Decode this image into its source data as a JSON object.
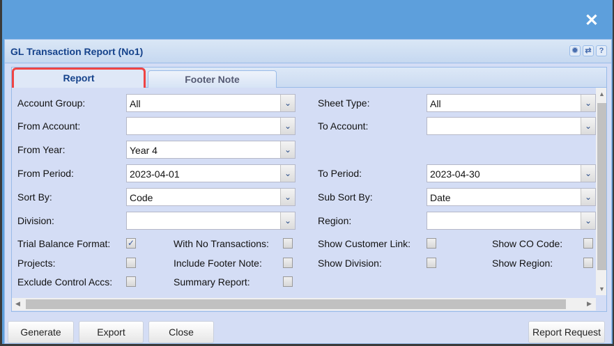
{
  "window": {
    "close_icon": "close-icon"
  },
  "dialog": {
    "title": "GL Transaction Report (No1)",
    "tools": [
      "gear-icon",
      "refresh-icon",
      "help-icon"
    ]
  },
  "tabs": [
    {
      "label": "Report",
      "active": true
    },
    {
      "label": "Footer Note",
      "active": false
    }
  ],
  "fields": {
    "account_group": {
      "label": "Account Group:",
      "value": "All"
    },
    "sheet_type": {
      "label": "Sheet Type:",
      "value": "All"
    },
    "from_account": {
      "label": "From Account:",
      "value": ""
    },
    "to_account": {
      "label": "To Account:",
      "value": ""
    },
    "from_year": {
      "label": "From Year:",
      "value": "Year 4"
    },
    "from_period": {
      "label": "From Period:",
      "value": "2023-04-01"
    },
    "to_period": {
      "label": "To Period:",
      "value": "2023-04-30"
    },
    "sort_by": {
      "label": "Sort By:",
      "value": "Code"
    },
    "sub_sort_by": {
      "label": "Sub Sort By:",
      "value": "Date"
    },
    "division": {
      "label": "Division:",
      "value": ""
    },
    "region": {
      "label": "Region:",
      "value": ""
    }
  },
  "checks": {
    "trial_balance": {
      "label": "Trial Balance Format:",
      "checked": true
    },
    "no_transactions": {
      "label": "With No Transactions:",
      "checked": false
    },
    "customer_link": {
      "label": "Show Customer Link:",
      "checked": false
    },
    "co_code": {
      "label": "Show CO Code:",
      "checked": false
    },
    "projects": {
      "label": "Projects:",
      "checked": false
    },
    "footer_note": {
      "label": "Include Footer Note:",
      "checked": false
    },
    "show_division": {
      "label": "Show Division:",
      "checked": false
    },
    "show_region": {
      "label": "Show Region:",
      "checked": false
    },
    "exclude_control": {
      "label": "Exclude Control Accs:",
      "checked": false
    },
    "summary": {
      "label": "Summary Report:",
      "checked": false
    }
  },
  "buttons": {
    "generate": "Generate",
    "export": "Export",
    "close": "Close",
    "report_request": "Report Request"
  }
}
